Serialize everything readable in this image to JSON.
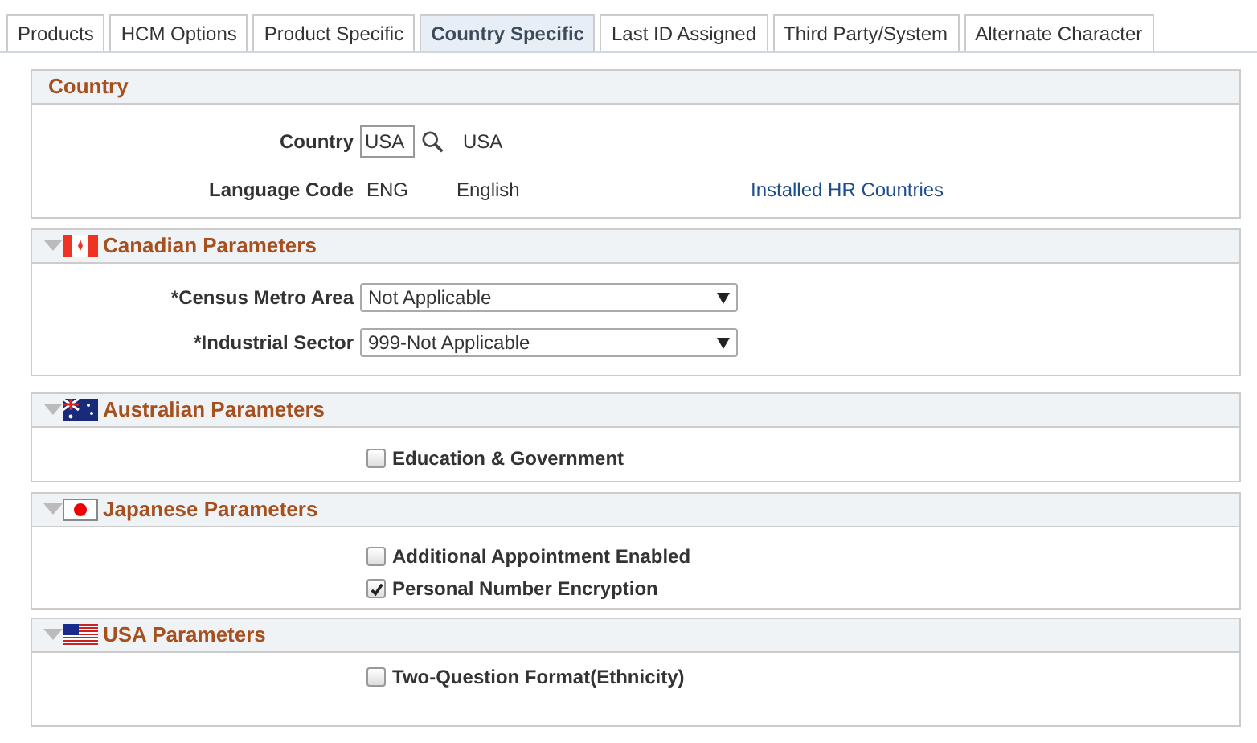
{
  "tabs": [
    {
      "label": "Products",
      "selected": false
    },
    {
      "label": "HCM Options",
      "selected": false
    },
    {
      "label": "Product Specific",
      "selected": false
    },
    {
      "label": "Country Specific",
      "selected": true
    },
    {
      "label": "Last ID Assigned",
      "selected": false
    },
    {
      "label": "Third Party/System",
      "selected": false
    },
    {
      "label": "Alternate Character",
      "selected": false
    }
  ],
  "sections": [
    {
      "title": "Country",
      "collapsible": false,
      "rows": [
        {
          "kind": "lookup",
          "label": "Country",
          "value": "USA",
          "description": "USA"
        },
        {
          "kind": "display",
          "label": "Language Code",
          "value": "ENG",
          "description": "English",
          "link": "Installed HR Countries"
        }
      ]
    },
    {
      "title": "Canadian Parameters",
      "collapsible": true,
      "rows": [
        {
          "kind": "select",
          "label": "*Census Metro Area",
          "value": "Not Applicable"
        },
        {
          "kind": "select",
          "label": "*Industrial Sector",
          "value": "999-Not Applicable"
        }
      ]
    },
    {
      "title": "Australian Parameters",
      "collapsible": true,
      "rows": [
        {
          "kind": "checkbox",
          "label": "Education & Government",
          "checked": false
        }
      ]
    },
    {
      "title": "Japanese Parameters",
      "collapsible": true,
      "rows": [
        {
          "kind": "checkbox",
          "label": "Additional Appointment Enabled",
          "checked": false
        },
        {
          "kind": "checkbox",
          "label": "Personal Number Encryption",
          "checked": true
        }
      ]
    },
    {
      "title": "USA Parameters",
      "collapsible": true,
      "rows": [
        {
          "kind": "checkbox",
          "label": "Two-Question Format(Ethnicity)",
          "checked": false
        }
      ]
    }
  ]
}
